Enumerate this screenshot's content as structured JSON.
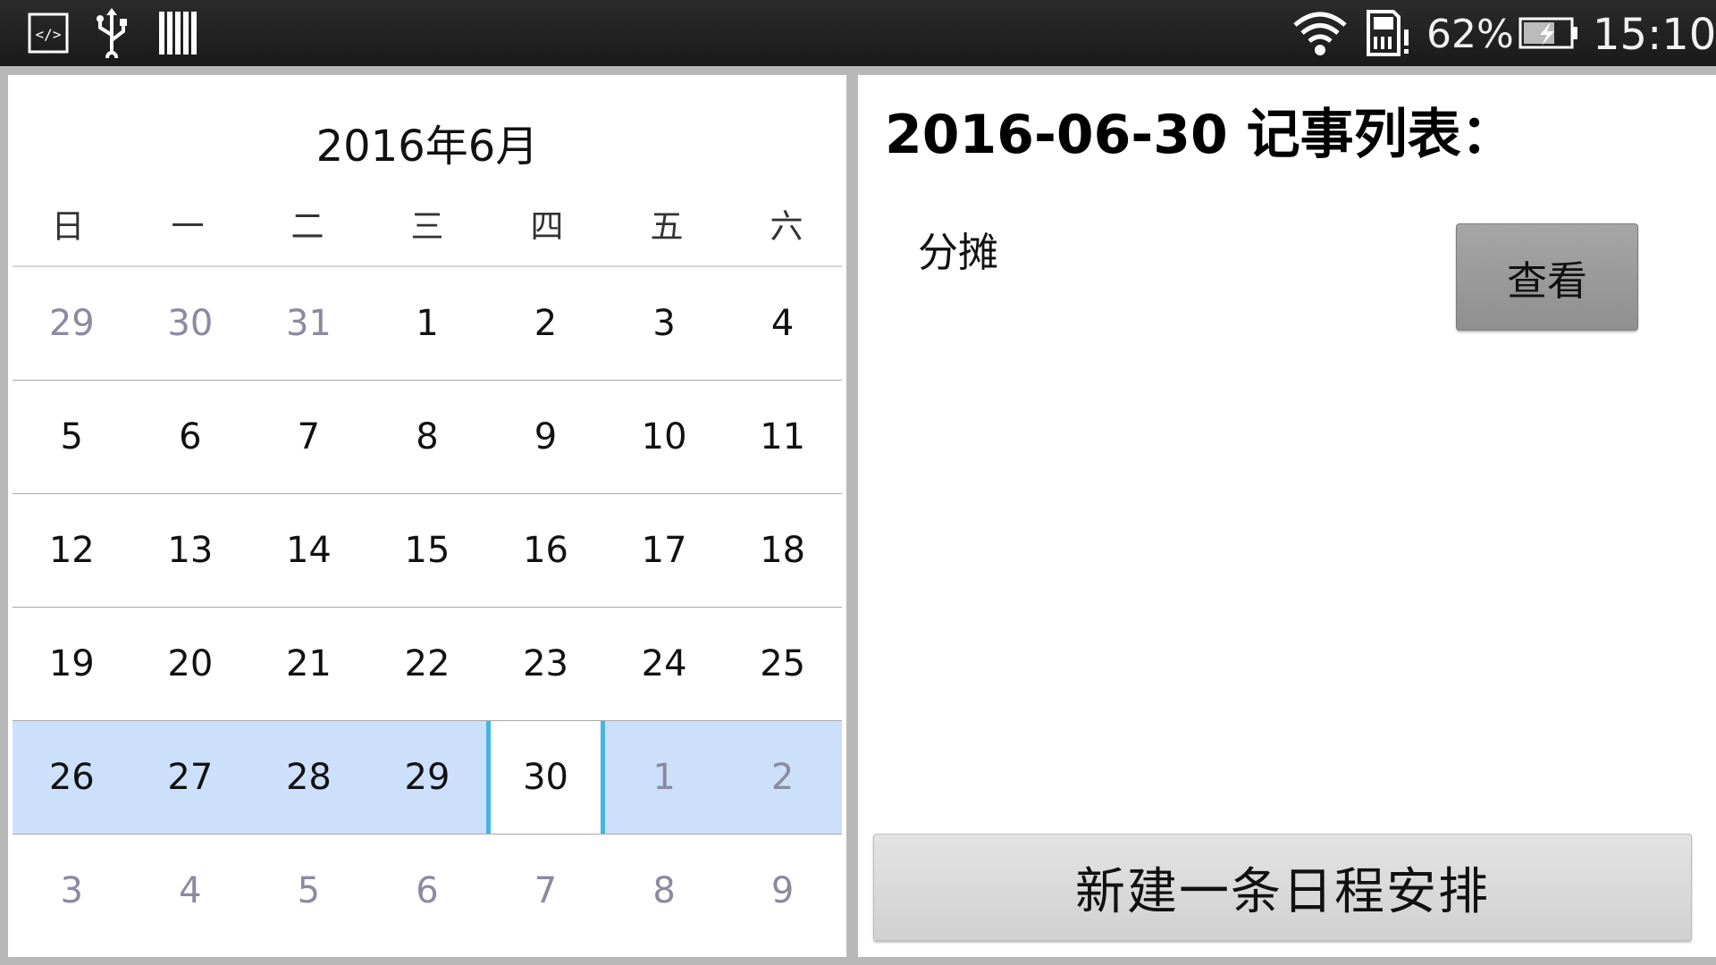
{
  "status_bar": {
    "left_icons": [
      "code-icon",
      "usb-icon",
      "barcode-icon"
    ],
    "right_icons": [
      "wifi-icon",
      "sd-card-icon",
      "battery-icon"
    ],
    "battery_percent": "62%",
    "time": "15:10"
  },
  "calendar": {
    "month_title": "2016年6月",
    "weekdays": [
      "日",
      "一",
      "二",
      "三",
      "四",
      "五",
      "六"
    ],
    "weeks": [
      [
        {
          "d": "29",
          "other": true
        },
        {
          "d": "30",
          "other": true
        },
        {
          "d": "31",
          "other": true
        },
        {
          "d": "1"
        },
        {
          "d": "2"
        },
        {
          "d": "3"
        },
        {
          "d": "4"
        }
      ],
      [
        {
          "d": "5"
        },
        {
          "d": "6"
        },
        {
          "d": "7"
        },
        {
          "d": "8"
        },
        {
          "d": "9"
        },
        {
          "d": "10"
        },
        {
          "d": "11"
        }
      ],
      [
        {
          "d": "12"
        },
        {
          "d": "13"
        },
        {
          "d": "14"
        },
        {
          "d": "15"
        },
        {
          "d": "16"
        },
        {
          "d": "17"
        },
        {
          "d": "18"
        }
      ],
      [
        {
          "d": "19"
        },
        {
          "d": "20"
        },
        {
          "d": "21"
        },
        {
          "d": "22"
        },
        {
          "d": "23"
        },
        {
          "d": "24"
        },
        {
          "d": "25"
        }
      ],
      [
        {
          "d": "26"
        },
        {
          "d": "27"
        },
        {
          "d": "28"
        },
        {
          "d": "29"
        },
        {
          "d": "30",
          "selected": true
        },
        {
          "d": "1",
          "other": true
        },
        {
          "d": "2",
          "other": true
        }
      ],
      [
        {
          "d": "3",
          "other": true
        },
        {
          "d": "4",
          "other": true
        },
        {
          "d": "5",
          "other": true
        },
        {
          "d": "6",
          "other": true
        },
        {
          "d": "7",
          "other": true
        },
        {
          "d": "8",
          "other": true
        },
        {
          "d": "9",
          "other": true
        }
      ]
    ],
    "selected_week_index": 4,
    "colors": {
      "selected_week_bg": "#cce0fc",
      "selected_day_border": "#45b4e6",
      "other_month_text": "#8a8aa0"
    }
  },
  "events": {
    "title": "2016-06-30 记事列表：",
    "items": [
      {
        "name": "分摊",
        "action": "查看"
      }
    ],
    "new_button": "新建一条日程安排"
  }
}
